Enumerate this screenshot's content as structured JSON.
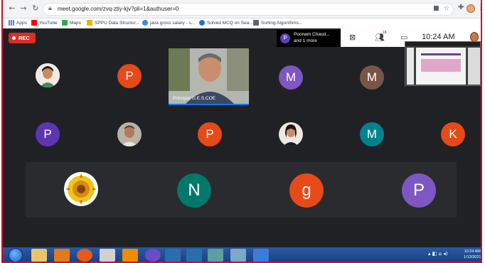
{
  "browser": {
    "url": "meet.google.com/zvq-ztiy-kjv?pli=1&authuser=0",
    "bookmarks": [
      {
        "label": "Apps",
        "color": "#4285f4"
      },
      {
        "label": "YouTube",
        "color": "#ff0000"
      },
      {
        "label": "Maps",
        "color": "#34a853"
      },
      {
        "label": "SPPU Data Structur...",
        "color": "#f4b400"
      },
      {
        "label": "java gross salary - s...",
        "color": "#4285f4"
      },
      {
        "label": "Solved MCQ on Sea...",
        "color": "#1a73e8"
      },
      {
        "label": "Sorting Algorithms...",
        "color": "#5f6368"
      }
    ]
  },
  "meet": {
    "rec_label": "REC",
    "presenter": {
      "initial": "P",
      "line1": "Poonam Chaud...",
      "line2": "and 1 more"
    },
    "participants_badge": "18",
    "time": "10:24 AM",
    "video_name": "Principal G.E.S.COE",
    "tiles_row1": [
      {
        "type": "photo",
        "name": "photo-tile-woman"
      },
      {
        "type": "initial",
        "letter": "P",
        "color": "#e64a19"
      },
      {
        "type": "video"
      },
      {
        "type": "initial",
        "letter": "M",
        "color": "#7e57c2"
      },
      {
        "type": "initial",
        "letter": "M",
        "color": "#795548"
      }
    ],
    "tiles_row2": [
      {
        "letter": "P",
        "color": "#5e35b1"
      },
      {
        "type": "photo"
      },
      {
        "letter": "P",
        "color": "#e64a19"
      },
      {
        "type": "photo"
      },
      {
        "letter": "M",
        "color": "#00838f"
      },
      {
        "letter": "K",
        "color": "#e64a19"
      }
    ],
    "tiles_row3": [
      {
        "type": "logo"
      },
      {
        "letter": "N",
        "color": "#00796b"
      },
      {
        "letter": "g",
        "color": "#e64a19"
      },
      {
        "letter": "P",
        "color": "#7e57c2"
      }
    ],
    "pip_title": "A Layered Technology"
  },
  "taskbar": {
    "clock_time": "10:24 AM",
    "clock_date": "1/13/2021"
  }
}
